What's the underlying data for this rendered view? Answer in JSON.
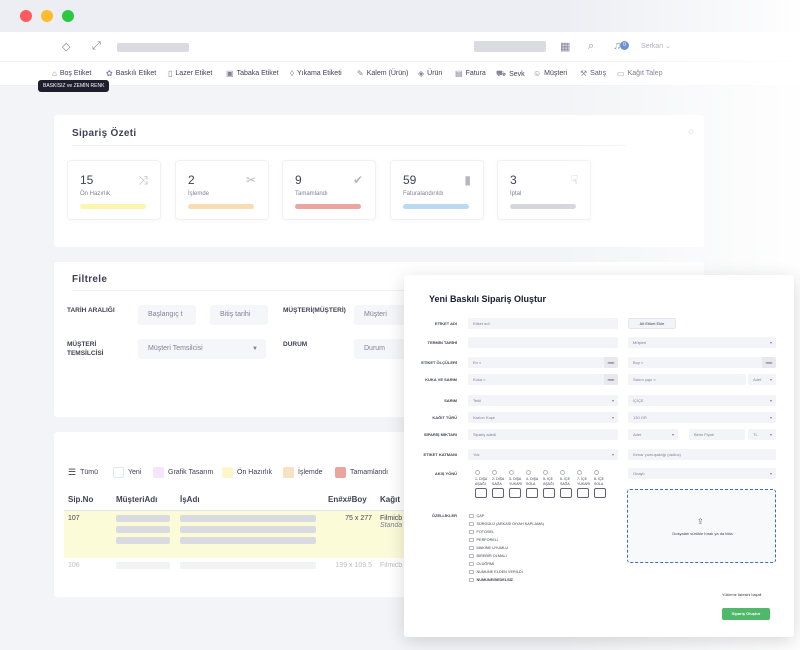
{
  "topbar": {
    "user_name": "Serkan",
    "notifications": "0"
  },
  "nav": {
    "items": [
      {
        "label": "Boş Etiket",
        "icon": "tag-icon"
      },
      {
        "label": "Baskılı Etiket",
        "icon": "palette-icon"
      },
      {
        "label": "Lazer Etiket",
        "icon": "file-icon"
      },
      {
        "label": "Tabaka Etiket",
        "icon": "sheet-icon"
      },
      {
        "label": "Yıkama Etiketi",
        "icon": "drop-icon"
      },
      {
        "label": "Kalem (Ürün)",
        "icon": "pen-icon"
      },
      {
        "label": "Ürün",
        "icon": "box-icon"
      },
      {
        "label": "Fatura",
        "icon": "invoice-icon"
      },
      {
        "label": "Sevk",
        "icon": "truck-icon"
      },
      {
        "label": "Müşteri",
        "icon": "users-icon"
      },
      {
        "label": "Satış",
        "icon": "cart-icon"
      },
      {
        "label": "Kağıt Talep",
        "icon": "folder-icon"
      }
    ],
    "tooltip": "BASKISIZ ve ZEMİN RENK"
  },
  "summary": {
    "title": "Sipariş Özeti",
    "stats": [
      {
        "value": "15",
        "label": "Ön Hazırlık",
        "icon": "shuffle-icon",
        "color": "#fbf5b0"
      },
      {
        "value": "2",
        "label": "İşlemde",
        "icon": "scissors-icon",
        "color": "#f7dcb4"
      },
      {
        "value": "9",
        "label": "Tamamlandı",
        "icon": "check-icon",
        "color": "#eca49e"
      },
      {
        "value": "59",
        "label": "Faturalandırıldı",
        "icon": "bookmark-icon",
        "color": "#bcd9f2"
      },
      {
        "value": "3",
        "label": "İptal",
        "icon": "thumbs-down-icon",
        "color": "#d5d6db"
      }
    ]
  },
  "filters": {
    "title": "Filtrele",
    "date_label": "TARİH ARALIĞI",
    "start_placeholder": "Başlangıç t",
    "end_placeholder": "Bitiş tarihi",
    "customer_label": "MÜŞTERİ(MÜŞTERİ)",
    "customer_value": "Müşteri",
    "rep_label": "MÜŞTERİ TEMSİLCİSİ",
    "rep_value": "Müşteri Temsilcisi",
    "status_label": "DURUM",
    "status_value": "Durum"
  },
  "legend": [
    {
      "label": "Tümü",
      "color": "#ffffff"
    },
    {
      "label": "Yeni",
      "color": "#ffffff"
    },
    {
      "label": "Grafik Tasarım",
      "color": "#f3e6fb"
    },
    {
      "label": "Ön Hazırlık",
      "color": "#fbf7c8"
    },
    {
      "label": "İşlemde",
      "color": "#f9e1c4"
    },
    {
      "label": "Tamamlandı",
      "color": "#eca49e"
    }
  ],
  "table": {
    "headers": [
      "Sip.No",
      "MüşteriAdı",
      "İşAdı",
      "En#x#Boy",
      "Kağıt"
    ],
    "rows": [
      {
        "no": "107",
        "size": "75 x 277",
        "paper": "Filmicb",
        "paper2": "Standa"
      },
      {
        "no": "106",
        "size": "199 x 109.5",
        "paper": "Filmicb",
        "paper2": ""
      }
    ]
  },
  "modal": {
    "title": "Yeni Baskılı Sipariş Oluştur",
    "labels": {
      "label_name": "ETİKET ADI",
      "deadline": "TERMİN TARİHİ",
      "dimensions": "ETİKET ÖLÇÜLERİ",
      "core": "KUKA VE SARIM",
      "winding": "SARIM",
      "paper": "KAĞIT TÜRÜ",
      "quantity": "SİPARİŞ MİKTARI",
      "layer": "ETİKET KATMANI",
      "direction": "AKIŞ YÖNÜ",
      "features": "ÖZELLİKLER"
    },
    "fields": {
      "label_name_ph": "Etiket adı",
      "add_label_btn": "Alt Etiket Ekle",
      "customer_ph": "Müşteri",
      "width_ph": "En  ≈",
      "height_ph": "Boy  ≈",
      "unit": "mm",
      "core_ph": "Kuka  ≈",
      "wind_ph": "Sarım çapı  ≈",
      "wind_unit": "Adet",
      "winding_value": "Tekli",
      "winding_right": "İÇİÇE",
      "paper_value": "Karton Kuşe",
      "paper_right": "130 GR",
      "quantity_ph": "Sipariş adedi",
      "qty_unit": "Adet",
      "price_ph": "Birim Fiyatı",
      "currency": "TL",
      "layer_value": "Yok",
      "note_ph": "Kenar yumuşaklığı (radius)",
      "approval": "Onaylı"
    },
    "directions": [
      "1- DIŞA AŞAĞI",
      "2- DIŞA SAĞA",
      "3- DIŞA YUKARI",
      "4- DIŞA SOLA",
      "5- İÇE AŞAĞI",
      "6- İÇE SAĞA",
      "7- İÇE YUKARI",
      "8- İÇE SOLA"
    ],
    "features": [
      "ÇAP",
      "SÜRGÜLÜ (ARKASI DİYAH KAPLAMA)",
      "FOTOSEL",
      "PERFORELİ",
      "MAKİNE UYUMLU",
      "BİREBİR OLMALI",
      "OLÜĞRMİ",
      "NUMUNE ELDEN VERİLDİ",
      "NUMUNE/BEDELSİZ"
    ],
    "dropzone_text": "Dosyaları sürükle bırak ya da tıkla",
    "reset_label": "Yükleme listesini başalt",
    "submit_label": "Sipariş Oluştur"
  }
}
